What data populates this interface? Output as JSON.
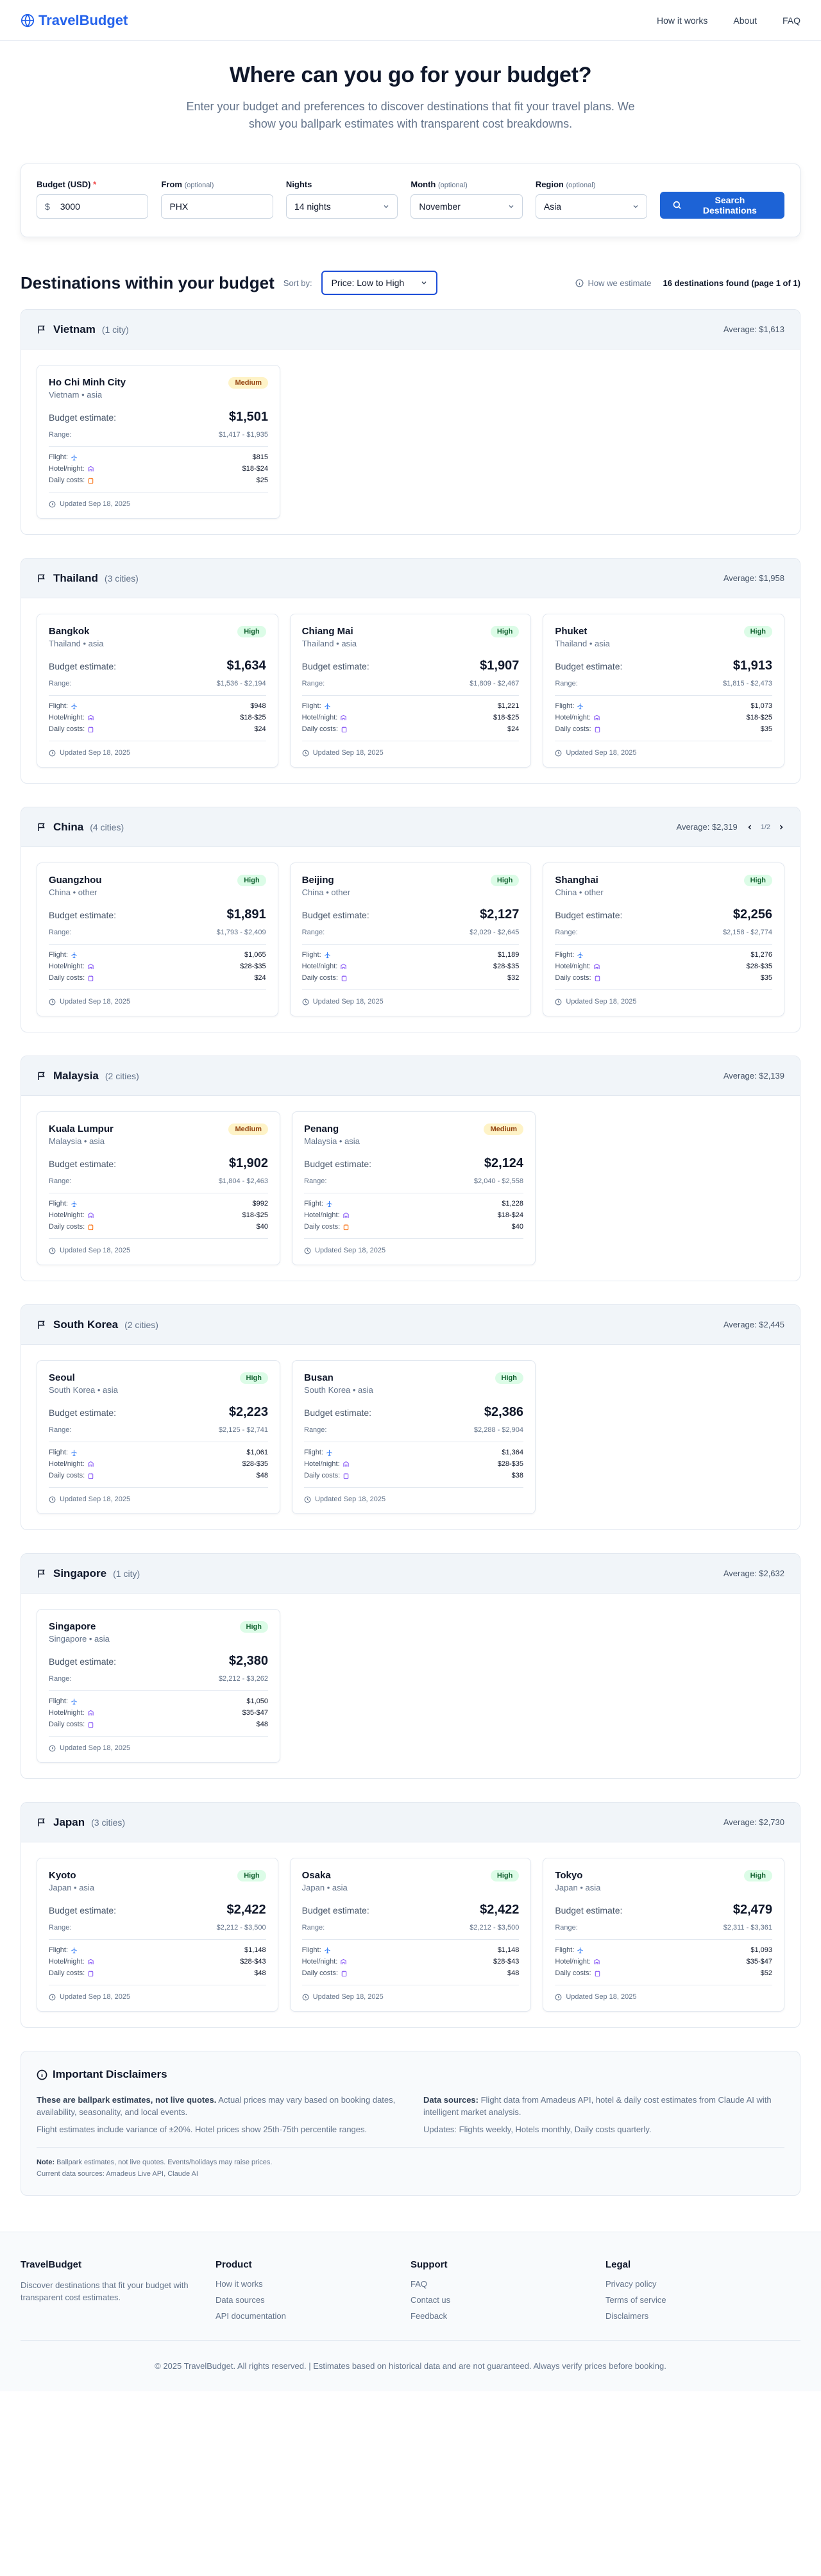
{
  "header": {
    "brand": "TravelBudget",
    "nav": [
      "How it works",
      "About",
      "FAQ"
    ]
  },
  "hero": {
    "title": "Where can you go for your budget?",
    "subtitle": "Enter your budget and preferences to discover destinations that fit your travel plans. We show you ballpark estimates with transparent cost breakdowns."
  },
  "search": {
    "budget_label": "Budget (USD)",
    "budget_required": "*",
    "budget_prefix": "$",
    "budget_value": "3000",
    "from_label": "From",
    "from_optional": "(optional)",
    "from_value": "PHX",
    "nights_label": "Nights",
    "nights_value": "14 nights",
    "month_label": "Month",
    "month_optional": "(optional)",
    "month_value": "November",
    "region_label": "Region",
    "region_optional": "(optional)",
    "region_value": "Asia",
    "button": "Search Destinations"
  },
  "results": {
    "title": "Destinations within your budget",
    "sort_label": "Sort by:",
    "sort_value": "Price: Low to High",
    "how_estimate": "How we estimate",
    "found": "16 destinations found (page 1 of 1)"
  },
  "labels": {
    "budget_estimate": "Budget estimate:",
    "range": "Range:",
    "flight": "Flight:",
    "hotel": "Hotel/night:",
    "daily": "Daily costs:"
  },
  "countries": [
    {
      "name": "Vietnam",
      "count": "(1 city)",
      "average": "Average: $1,613",
      "cities": [
        {
          "city": "Ho Chi Minh City",
          "sub": "Vietnam • asia",
          "badge": "Medium",
          "level": "medium",
          "estimate": "$1,501",
          "range": "$1,417 - $1,935",
          "flight": "$815",
          "hotel": "$18-$24",
          "daily": "$25",
          "daily_icon": "orange",
          "updated": "Updated Sep 18, 2025"
        }
      ]
    },
    {
      "name": "Thailand",
      "count": "(3 cities)",
      "average": "Average: $1,958",
      "cities": [
        {
          "city": "Bangkok",
          "sub": "Thailand • asia",
          "badge": "High",
          "level": "high",
          "estimate": "$1,634",
          "range": "$1,536 - $2,194",
          "flight": "$948",
          "hotel": "$18-$25",
          "daily": "$24",
          "daily_icon": "purple",
          "updated": "Updated Sep 18, 2025"
        },
        {
          "city": "Chiang Mai",
          "sub": "Thailand • asia",
          "badge": "High",
          "level": "high",
          "estimate": "$1,907",
          "range": "$1,809 - $2,467",
          "flight": "$1,221",
          "hotel": "$18-$25",
          "daily": "$24",
          "daily_icon": "purple",
          "updated": "Updated Sep 18, 2025"
        },
        {
          "city": "Phuket",
          "sub": "Thailand • asia",
          "badge": "High",
          "level": "high",
          "estimate": "$1,913",
          "range": "$1,815 - $2,473",
          "flight": "$1,073",
          "hotel": "$18-$25",
          "daily": "$35",
          "daily_icon": "purple",
          "updated": "Updated Sep 18, 2025"
        }
      ]
    },
    {
      "name": "China",
      "count": "(4 cities)",
      "average": "Average: $2,319",
      "pager": "1/2",
      "cities": [
        {
          "city": "Guangzhou",
          "sub": "China • other",
          "badge": "High",
          "level": "high",
          "estimate": "$1,891",
          "range": "$1,793 - $2,409",
          "flight": "$1,065",
          "hotel": "$28-$35",
          "daily": "$24",
          "daily_icon": "purple",
          "updated": "Updated Sep 18, 2025"
        },
        {
          "city": "Beijing",
          "sub": "China • other",
          "badge": "High",
          "level": "high",
          "estimate": "$2,127",
          "range": "$2,029 - $2,645",
          "flight": "$1,189",
          "hotel": "$28-$35",
          "daily": "$32",
          "daily_icon": "purple",
          "updated": "Updated Sep 18, 2025"
        },
        {
          "city": "Shanghai",
          "sub": "China • other",
          "badge": "High",
          "level": "high",
          "estimate": "$2,256",
          "range": "$2,158 - $2,774",
          "flight": "$1,276",
          "hotel": "$28-$35",
          "daily": "$35",
          "daily_icon": "purple",
          "updated": "Updated Sep 18, 2025"
        }
      ]
    },
    {
      "name": "Malaysia",
      "count": "(2 cities)",
      "average": "Average: $2,139",
      "cities": [
        {
          "city": "Kuala Lumpur",
          "sub": "Malaysia • asia",
          "badge": "Medium",
          "level": "medium",
          "estimate": "$1,902",
          "range": "$1,804 - $2,463",
          "flight": "$992",
          "hotel": "$18-$25",
          "daily": "$40",
          "daily_icon": "orange",
          "updated": "Updated Sep 18, 2025"
        },
        {
          "city": "Penang",
          "sub": "Malaysia • asia",
          "badge": "Medium",
          "level": "medium",
          "estimate": "$2,124",
          "range": "$2,040 - $2,558",
          "flight": "$1,228",
          "hotel": "$18-$24",
          "daily": "$40",
          "daily_icon": "orange",
          "updated": "Updated Sep 18, 2025"
        }
      ]
    },
    {
      "name": "South Korea",
      "count": "(2 cities)",
      "average": "Average: $2,445",
      "cities": [
        {
          "city": "Seoul",
          "sub": "South Korea • asia",
          "badge": "High",
          "level": "high",
          "estimate": "$2,223",
          "range": "$2,125 - $2,741",
          "flight": "$1,061",
          "hotel": "$28-$35",
          "daily": "$48",
          "daily_icon": "purple",
          "updated": "Updated Sep 18, 2025"
        },
        {
          "city": "Busan",
          "sub": "South Korea • asia",
          "badge": "High",
          "level": "high",
          "estimate": "$2,386",
          "range": "$2,288 - $2,904",
          "flight": "$1,364",
          "hotel": "$28-$35",
          "daily": "$38",
          "daily_icon": "purple",
          "updated": "Updated Sep 18, 2025"
        }
      ]
    },
    {
      "name": "Singapore",
      "count": "(1 city)",
      "average": "Average: $2,632",
      "cities": [
        {
          "city": "Singapore",
          "sub": "Singapore • asia",
          "badge": "High",
          "level": "high",
          "estimate": "$2,380",
          "range": "$2,212 - $3,262",
          "flight": "$1,050",
          "hotel": "$35-$47",
          "daily": "$48",
          "daily_icon": "purple",
          "updated": "Updated Sep 18, 2025"
        }
      ]
    },
    {
      "name": "Japan",
      "count": "(3 cities)",
      "average": "Average: $2,730",
      "cities": [
        {
          "city": "Kyoto",
          "sub": "Japan • asia",
          "badge": "High",
          "level": "high",
          "estimate": "$2,422",
          "range": "$2,212 - $3,500",
          "flight": "$1,148",
          "hotel": "$28-$43",
          "daily": "$48",
          "daily_icon": "purple",
          "updated": "Updated Sep 18, 2025"
        },
        {
          "city": "Osaka",
          "sub": "Japan • asia",
          "badge": "High",
          "level": "high",
          "estimate": "$2,422",
          "range": "$2,212 - $3,500",
          "flight": "$1,148",
          "hotel": "$28-$43",
          "daily": "$48",
          "daily_icon": "purple",
          "updated": "Updated Sep 18, 2025"
        },
        {
          "city": "Tokyo",
          "sub": "Japan • asia",
          "badge": "High",
          "level": "high",
          "estimate": "$2,479",
          "range": "$2,311 - $3,361",
          "flight": "$1,093",
          "hotel": "$35-$47",
          "daily": "$52",
          "daily_icon": "purple",
          "updated": "Updated Sep 18, 2025"
        }
      ]
    }
  ],
  "disclaimer": {
    "title": "Important Disclaimers",
    "left_bold": "These are ballpark estimates, not live quotes.",
    "left_text": " Actual prices may vary based on booking dates, availability, seasonality, and local events.",
    "left_p2": "Flight estimates include variance of ±20%. Hotel prices show 25th-75th percentile ranges.",
    "right_bold": "Data sources:",
    "right_text": " Flight data from Amadeus API, hotel & daily cost estimates from Claude AI with intelligent market analysis.",
    "right_p2": "Updates: Flights weekly, Hotels monthly, Daily costs quarterly.",
    "note_bold": "Note:",
    "note_text": " Ballpark estimates, not live quotes. Events/holidays may raise prices.",
    "note_sources": "Current data sources: Amadeus Live API, Claude AI"
  },
  "footer": {
    "brand": "TravelBudget",
    "tagline": "Discover destinations that fit your budget with transparent cost estimates.",
    "product_title": "Product",
    "product_links": [
      "How it works",
      "Data sources",
      "API documentation"
    ],
    "support_title": "Support",
    "support_links": [
      "FAQ",
      "Contact us",
      "Feedback"
    ],
    "legal_title": "Legal",
    "legal_links": [
      "Privacy policy",
      "Terms of service",
      "Disclaimers"
    ],
    "copyright": "© 2025 TravelBudget. All rights reserved. | Estimates based on historical data and are not guaranteed. Always verify prices before booking."
  },
  "colors": {
    "accent": "#2563eb",
    "button": "#1d63d6",
    "high_bg": "#dcfce7",
    "medium_bg": "#fef3c7"
  }
}
